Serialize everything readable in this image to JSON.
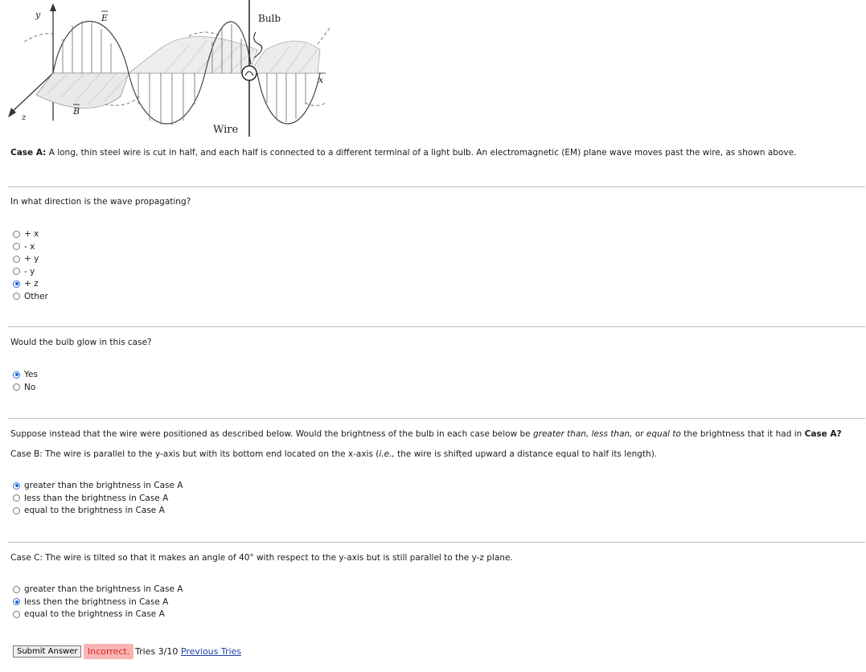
{
  "figure": {
    "labels": {
      "y_axis": "y",
      "e_field": "E",
      "bulb": "Bulb",
      "x_axis": "x",
      "z_axis": "z",
      "b_field": "B",
      "wire": "Wire"
    }
  },
  "case_a": {
    "label": "Case A:",
    "text": "A long, thin steel wire is cut in half, and each half is connected to a different terminal of a light bulb.  An electromagnetic (EM) plane wave moves past the wire, as shown above."
  },
  "q1": {
    "prompt": "In what direction is the wave propagating?",
    "options": [
      "+ x",
      "- x",
      "+ y",
      "- y",
      "+ z",
      "Other"
    ],
    "selected_index": 4
  },
  "q2": {
    "prompt": "Would the bulb glow in this case?",
    "options": [
      "Yes",
      "No"
    ],
    "selected_index": 0
  },
  "q3": {
    "prompt_start": "Suppose instead that the wire were positioned as described below.  Would the brightness of the bulb in each case below be ",
    "prompt_greater": "greater than,",
    "prompt_less": "less than,",
    "prompt_or": " or ",
    "prompt_equal": "equal to",
    "prompt_tail": " the brightness that it had in ",
    "prompt_case": "Case A?",
    "case_b_start": "Case B:  The wire is parallel to the y-axis but with its bottom end located on the x-axis (",
    "case_b_ie": "i.e.,",
    "case_b_end": " the wire is shifted upward a distance equal to half its length).",
    "options": [
      "greater than the brightness in Case A",
      "less than the brightness in Case A",
      "equal to the brightness in Case A"
    ],
    "selected_index": 0
  },
  "q4": {
    "case_c": "Case C:  The wire is tilted so that it makes an angle of 40° with respect to the y-axis but is still parallel to the y-z plane.",
    "options": [
      "greater than the brightness in Case A",
      "less then the brightness in Case A",
      "equal to the brightness in Case A"
    ],
    "selected_index": 1
  },
  "footer": {
    "submit_label": "Submit Answer",
    "status": "Incorrect.",
    "tries": "Tries 3/10",
    "previous_tries": "Previous Tries"
  },
  "colors": {
    "radio_checked": "#1c64cf",
    "incorrect_bg": "#f8b4b4",
    "incorrect_text": "#dd2222",
    "link": "#1f3ea8"
  }
}
